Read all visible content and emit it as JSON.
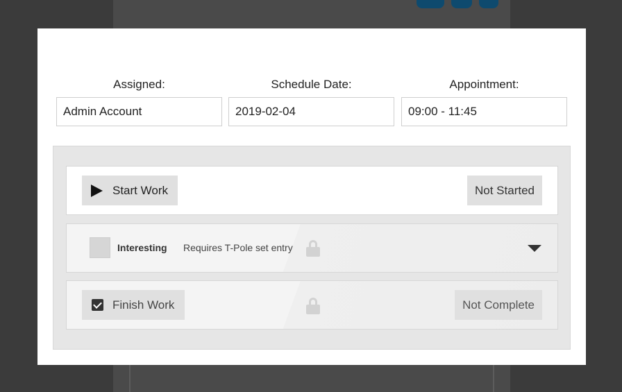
{
  "fields": {
    "assigned": {
      "label": "Assigned:",
      "value": "Admin Account"
    },
    "schedule_date": {
      "label": "Schedule Date:",
      "value": "2019-02-04"
    },
    "appointment": {
      "label": "Appointment:",
      "value": "09:00 - 11:45"
    }
  },
  "steps": {
    "start": {
      "button_label": "Start Work",
      "status": "Not Started",
      "icon": "play-icon"
    },
    "item": {
      "name": "Interesting",
      "description": "Requires T-Pole set entry",
      "icon": "lock-icon",
      "toggle_icon": "chevron-down-icon"
    },
    "finish": {
      "button_label": "Finish Work",
      "status": "Not Complete",
      "icon": "checkbox-icon",
      "lock_icon": "lock-icon"
    }
  },
  "colors": {
    "panel_bg": "#e6e6e6",
    "button_bg": "#e0e0e0",
    "backdrop": "#3b3b3b",
    "accent_bg_buttons": "#0e4a6e"
  }
}
